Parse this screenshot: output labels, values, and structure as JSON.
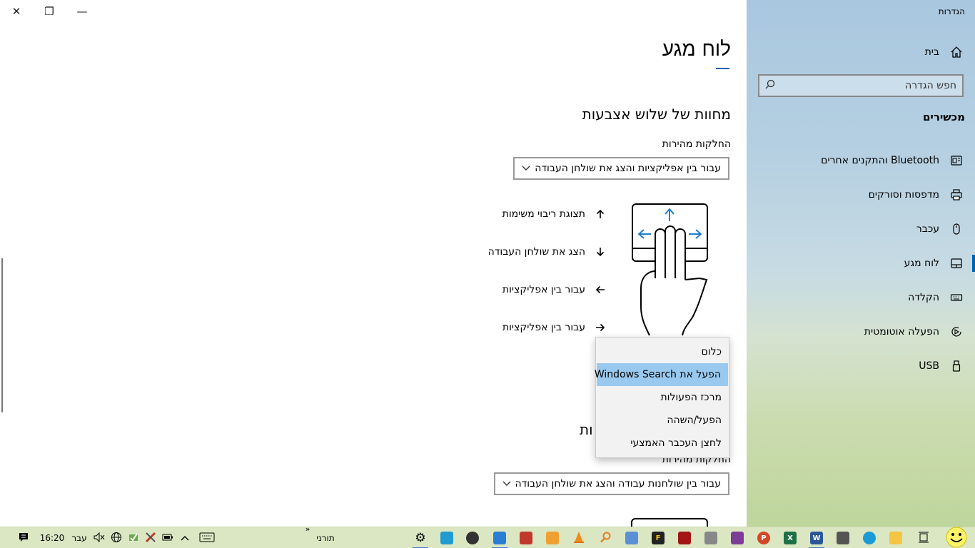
{
  "window": {
    "close_glyph": "✕",
    "restore_glyph": "❐",
    "minimize_glyph": "—"
  },
  "main": {
    "page_title": "לוח מגע",
    "three_finger": {
      "heading": "מחוות של שלוש אצבעות",
      "swipes_label": "החלקות מהירות",
      "swipes_value": "עבור בין אפליקציות והצג את שולחן העבודה",
      "gestures": [
        {
          "arrow": "up",
          "text": "תצוגת ריבוי משימות"
        },
        {
          "arrow": "down",
          "text": "הצג את שולחן העבודה"
        },
        {
          "arrow": "left",
          "text": "עבור בין אפליקציות"
        },
        {
          "arrow": "right",
          "text": "עבור בין אפליקציות"
        }
      ]
    },
    "dropdown": {
      "options": [
        "כלום",
        "הפעל את Windows Search",
        "מרכז הפעולות",
        "הפעל/השהה",
        "לחצן העכבר האמצעי"
      ],
      "selected_index": 1
    },
    "four_finger": {
      "heading_visible": "ות",
      "swipes_label": "החלקות מהירות",
      "swipes_value": "עבור בין שולחנות עבודה והצג את שולחן העבודה"
    }
  },
  "sidebar": {
    "app_title": "הגדרות",
    "home_label": "בית",
    "search_placeholder": "חפש הגדרה",
    "section_title": "מכשירים",
    "items": [
      {
        "label": "Bluetooth והתקנים אחרים",
        "icon": "bluetooth-devices-icon"
      },
      {
        "label": "מדפסות וסורקים",
        "icon": "printer-icon"
      },
      {
        "label": "עכבר",
        "icon": "mouse-icon"
      },
      {
        "label": "לוח מגע",
        "icon": "touchpad-icon",
        "active": true
      },
      {
        "label": "הקלדה",
        "icon": "keyboard-icon"
      },
      {
        "label": "הפעלה אוטומטית",
        "icon": "autoplay-icon"
      },
      {
        "label": "USB",
        "icon": "usb-icon"
      }
    ],
    "accent_color": "#0063b1"
  },
  "taskbar": {
    "time": "16:20",
    "language": "עבר",
    "toolbar_label": "תורני",
    "toolbar_chevron": "»",
    "colors": {
      "background": "#dbe7c3"
    }
  }
}
